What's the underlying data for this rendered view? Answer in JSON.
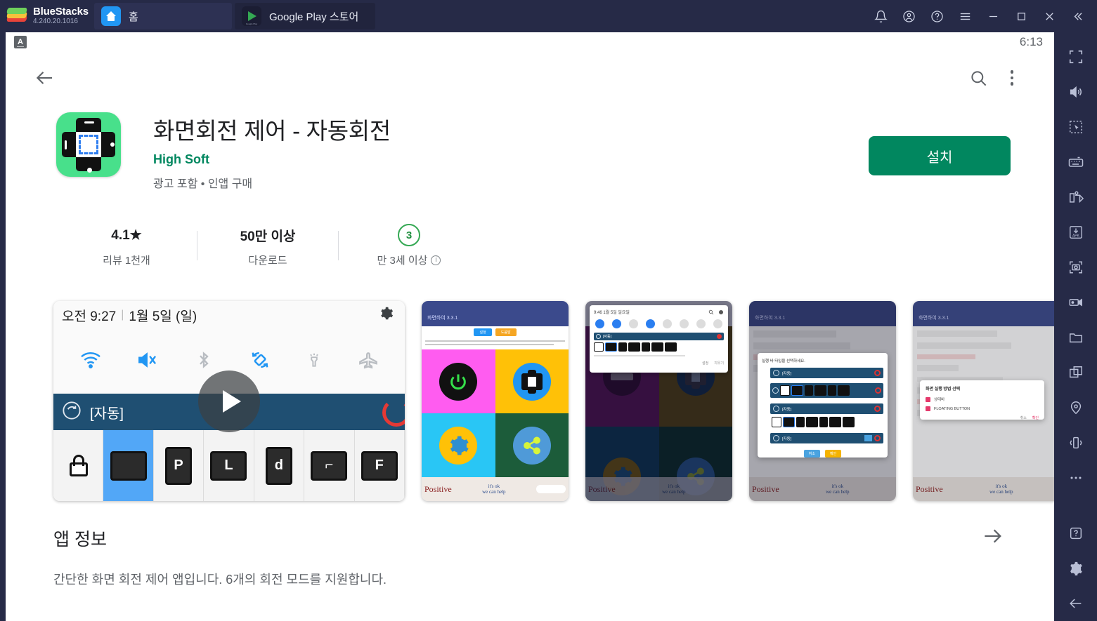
{
  "titlebar": {
    "brand_name": "BlueStacks",
    "version": "4.240.20.1016",
    "tabs": [
      {
        "label": "홈",
        "icon": "home-icon",
        "active": false
      },
      {
        "label": "Google Play 스토어",
        "icon": "google-play-icon",
        "active": true,
        "icon_caption": "Google Play"
      }
    ],
    "controls": [
      {
        "name": "notifications-button",
        "icon": "bell-icon"
      },
      {
        "name": "account-button",
        "icon": "user-circle-icon"
      },
      {
        "name": "help-button",
        "icon": "question-circle-icon"
      },
      {
        "name": "menu-button",
        "icon": "hamburger-icon"
      },
      {
        "name": "minimize-button",
        "icon": "minimize-icon"
      },
      {
        "name": "maximize-button",
        "icon": "maximize-icon"
      },
      {
        "name": "close-button",
        "icon": "close-icon"
      },
      {
        "name": "collapse-sidebar-button",
        "icon": "double-chevron-left-icon"
      }
    ]
  },
  "android": {
    "status_bar": {
      "badge": "A",
      "clock": "6:13"
    },
    "toolbar": {
      "back_icon": "arrow-left-icon",
      "search_icon": "search-icon",
      "overflow_icon": "kebab-menu-icon"
    }
  },
  "app": {
    "title": "화면회전 제어 - 자동회전",
    "developer": "High Soft",
    "subtitle": "광고 포함 • 인앱 구매",
    "install_label": "설치",
    "icon_name": "screen-rotation-app-icon"
  },
  "stats": [
    {
      "top": "4.1★",
      "bottom": "리뷰 1천개",
      "kind": "rating"
    },
    {
      "top": "50만 이상",
      "bottom": "다운로드",
      "kind": "downloads"
    },
    {
      "top": "3",
      "bottom": "만 3세 이상",
      "kind": "content-rating",
      "has_info_icon": true
    }
  ],
  "screenshots": [
    {
      "kind": "video",
      "name": "promo-video-thumbnail",
      "play_button": "play-icon",
      "quick_settings": {
        "time": "오전 9:27",
        "date": "1월 5일 (일)",
        "gear_icon": "gear-icon",
        "toggles": [
          "wifi-icon",
          "mute-icon",
          "bluetooth-icon",
          "rotate-icon",
          "flashlight-icon",
          "airplane-icon"
        ],
        "notification_label": "[자동]",
        "mode_tiles": [
          "lock",
          "auto",
          "P",
          "L",
          "d",
          "7",
          "F"
        ],
        "selected_mode_index": 1
      }
    },
    {
      "kind": "screenshot",
      "name": "screenshot-grid-modes",
      "title": "화면하여 3.3.1"
    },
    {
      "kind": "screenshot",
      "name": "screenshot-notification-panel",
      "title": "9:46  1월 5일 일요일"
    },
    {
      "kind": "screenshot",
      "name": "screenshot-mode-dialog",
      "title": "화면하여 3.3.1"
    },
    {
      "kind": "screenshot",
      "name": "screenshot-settings-dialog",
      "title": "화면하여 3.3.1",
      "dialog_title": "화면 실행 방법 선택",
      "dialog_options": [
        "상태바",
        "FLOATING BUTTON"
      ],
      "dialog_buttons": [
        "취소",
        "확인"
      ]
    }
  ],
  "app_info": {
    "heading": "앱 정보",
    "arrow_icon": "arrow-right-icon",
    "description": "간단한 화면 회전 제어 앱입니다. 6개의 회전 모드를 지원합니다."
  },
  "dock": [
    {
      "name": "fullscreen-button",
      "icon": "fullscreen-icon"
    },
    {
      "name": "volume-button",
      "icon": "speaker-icon"
    },
    {
      "name": "multi-select-button",
      "icon": "marquee-cursor-icon"
    },
    {
      "name": "keymapping-button",
      "icon": "keyboard-icon"
    },
    {
      "name": "macro-button",
      "icon": "macro-play-icon"
    },
    {
      "name": "install-apk-button",
      "icon": "apk-download-icon"
    },
    {
      "name": "screenshot-button",
      "icon": "camera-icon"
    },
    {
      "name": "record-button",
      "icon": "video-camera-icon"
    },
    {
      "name": "media-manager-button",
      "icon": "folder-icon"
    },
    {
      "name": "multi-instance-button",
      "icon": "windows-stack-icon"
    },
    {
      "name": "location-button",
      "icon": "map-pin-icon"
    },
    {
      "name": "shake-button",
      "icon": "shake-phone-icon"
    },
    {
      "name": "more-button",
      "icon": "ellipsis-icon"
    },
    {
      "name": "help-button",
      "icon": "question-box-icon"
    },
    {
      "name": "settings-button",
      "icon": "gear-icon"
    },
    {
      "name": "back-button",
      "icon": "arrow-left-icon"
    }
  ],
  "colors": {
    "chrome": "#262a47",
    "accent_green": "#01875f",
    "dev_green": "#01875f",
    "icon_green": "#48e08b",
    "text_primary": "#202124",
    "text_secondary": "#5f6368"
  }
}
